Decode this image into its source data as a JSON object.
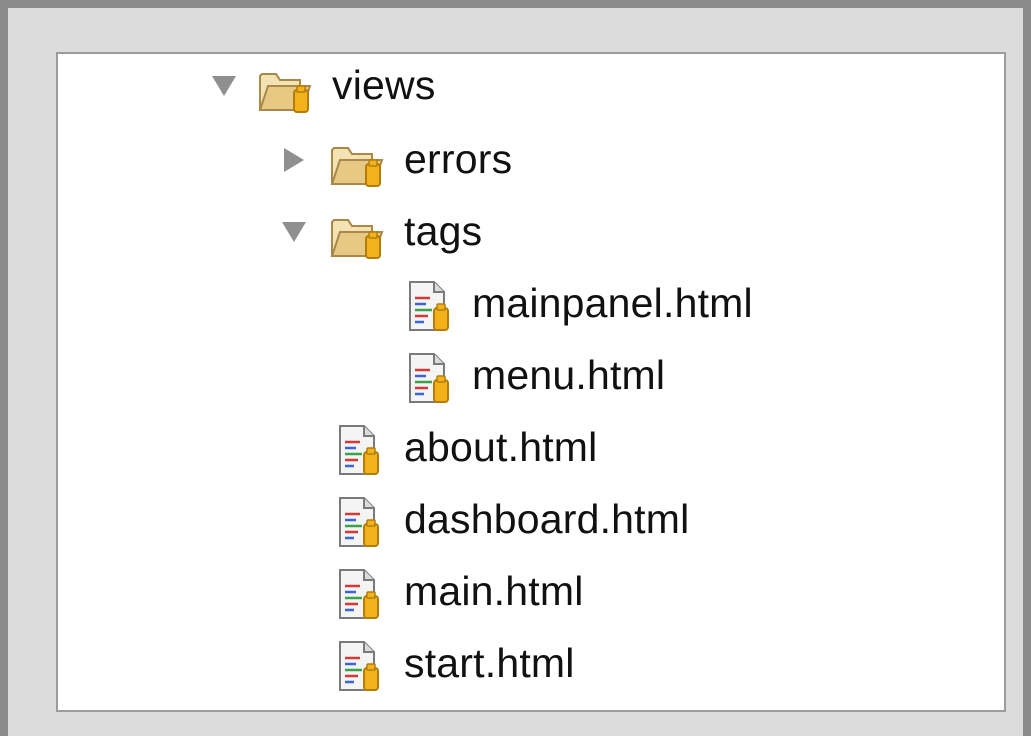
{
  "tree": {
    "items": [
      {
        "label": "views",
        "type": "folder",
        "expanded": true,
        "depth": 0
      },
      {
        "label": "errors",
        "type": "folder",
        "expanded": false,
        "depth": 1
      },
      {
        "label": "tags",
        "type": "folder",
        "expanded": true,
        "depth": 1
      },
      {
        "label": "mainpanel.html",
        "type": "file",
        "depth": 2
      },
      {
        "label": "menu.html",
        "type": "file",
        "depth": 2
      },
      {
        "label": "about.html",
        "type": "file",
        "depth": 1
      },
      {
        "label": "dashboard.html",
        "type": "file",
        "depth": 1
      },
      {
        "label": "main.html",
        "type": "file",
        "depth": 1
      },
      {
        "label": "start.html",
        "type": "file",
        "depth": 1
      }
    ]
  },
  "icons": {
    "expanded": "triangle-down-icon",
    "collapsed": "triangle-right-icon",
    "folder": "folder-open-icon",
    "file": "html-file-icon"
  },
  "colors": {
    "folder_tan": "#e7c983",
    "folder_outline": "#a9884a",
    "jar_gold": "#f2b21b",
    "triangle_gray": "#8f8f8f"
  }
}
